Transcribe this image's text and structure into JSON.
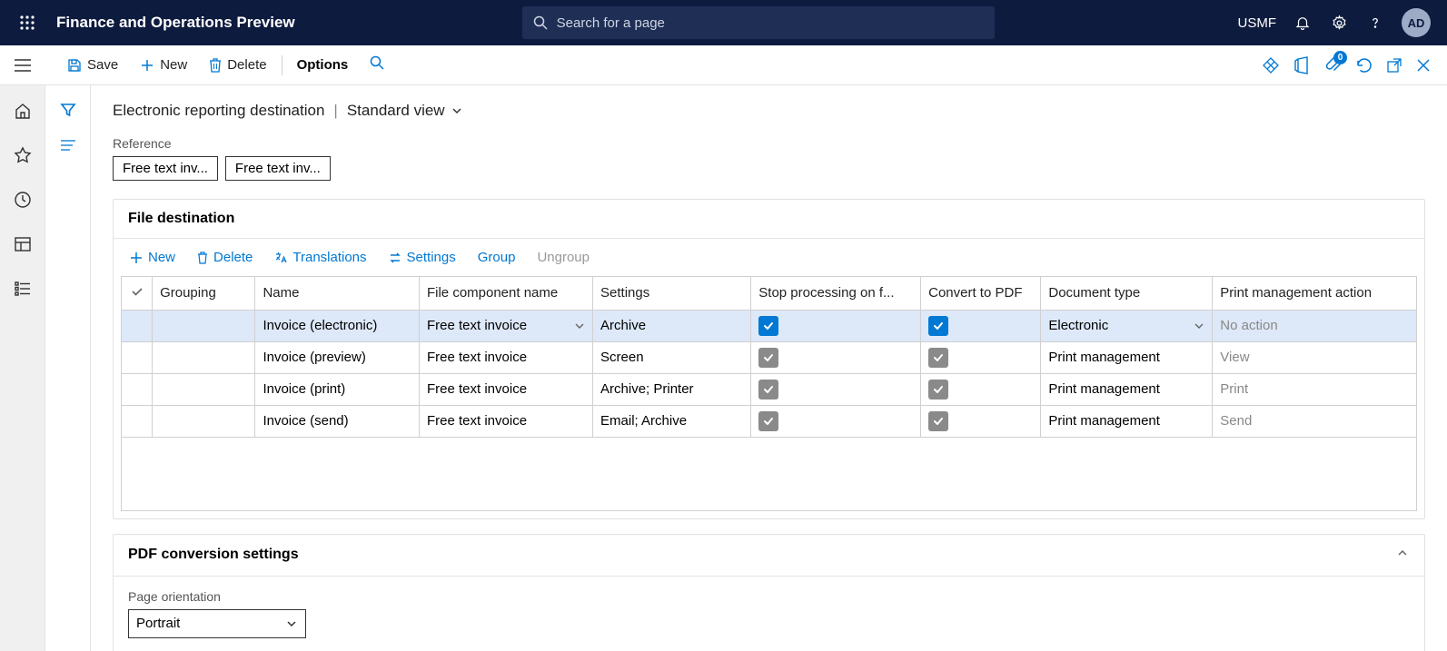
{
  "header": {
    "app_title": "Finance and Operations Preview",
    "search_placeholder": "Search for a page",
    "entity": "USMF",
    "avatar": "AD"
  },
  "commands": {
    "save": "Save",
    "new": "New",
    "delete": "Delete",
    "options": "Options",
    "attach_count": "0"
  },
  "breadcrumb": {
    "page": "Electronic reporting destination",
    "view": "Standard view"
  },
  "reference": {
    "label": "Reference",
    "pills": [
      "Free text inv...",
      "Free text inv..."
    ]
  },
  "file_destination": {
    "title": "File destination",
    "toolbar": {
      "new": "New",
      "delete": "Delete",
      "translations": "Translations",
      "settings": "Settings",
      "group": "Group",
      "ungroup": "Ungroup"
    },
    "columns": {
      "grouping": "Grouping",
      "name": "Name",
      "file_component": "File component name",
      "settings": "Settings",
      "stop": "Stop processing on f...",
      "convert": "Convert to PDF",
      "doctype": "Document type",
      "pma": "Print management action"
    },
    "rows": [
      {
        "name": "Invoice (electronic)",
        "fcomp": "Free text invoice",
        "settings": "Archive",
        "stop": true,
        "stop_style": "blue",
        "convert": true,
        "convert_style": "blue",
        "doctype": "Electronic",
        "pma": "No action",
        "pma_muted": true,
        "selected": true,
        "fcomp_dd": true,
        "doctype_dd": true
      },
      {
        "name": "Invoice (preview)",
        "fcomp": "Free text invoice",
        "settings": "Screen",
        "stop": true,
        "stop_style": "grey",
        "convert": true,
        "convert_style": "grey",
        "doctype": "Print management",
        "pma": "View",
        "pma_muted": true
      },
      {
        "name": "Invoice (print)",
        "fcomp": "Free text invoice",
        "settings": "Archive; Printer",
        "stop": true,
        "stop_style": "grey",
        "convert": true,
        "convert_style": "grey",
        "doctype": "Print management",
        "pma": "Print",
        "pma_muted": true
      },
      {
        "name": "Invoice (send)",
        "fcomp": "Free text invoice",
        "settings": "Email; Archive",
        "stop": true,
        "stop_style": "grey",
        "convert": true,
        "convert_style": "grey",
        "doctype": "Print management",
        "pma": "Send",
        "pma_muted": true
      }
    ]
  },
  "pdf_section": {
    "title": "PDF conversion settings",
    "orientation_label": "Page orientation",
    "orientation_value": "Portrait"
  }
}
